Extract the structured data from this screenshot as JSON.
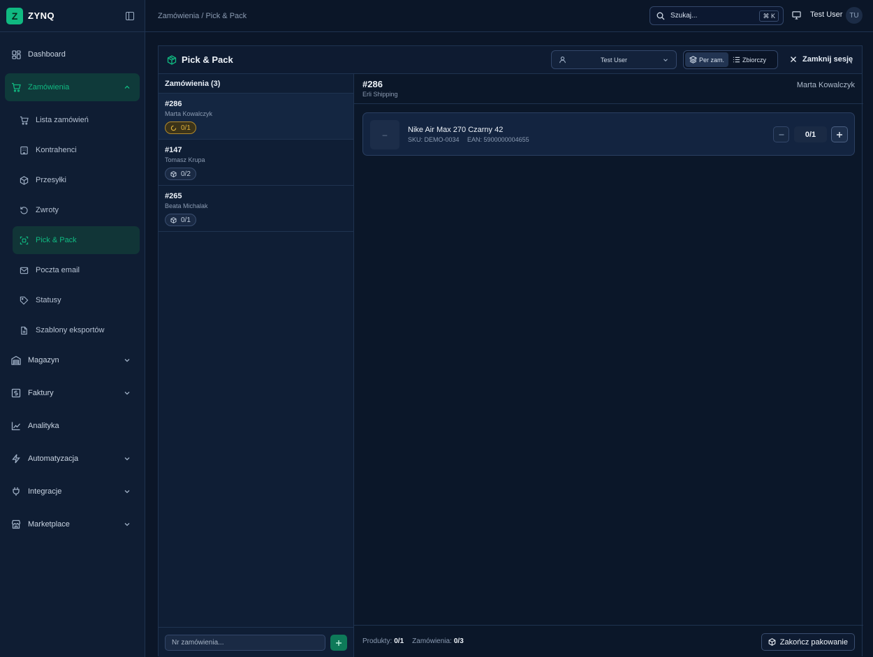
{
  "brand": {
    "logo_letter": "Z",
    "name": "ZYNQ"
  },
  "colors": {
    "accent": "#10b981",
    "warn": "#e0b23a",
    "background": "#0b1628"
  },
  "sidebar": {
    "items": [
      {
        "label": "Dashboard",
        "icon": "grid-icon"
      },
      {
        "label": "Zamówienia",
        "icon": "cart-icon",
        "open": true
      },
      {
        "label": "Magazyn",
        "icon": "warehouse-icon"
      },
      {
        "label": "Faktury",
        "icon": "invoice-icon"
      },
      {
        "label": "Analityka",
        "icon": "chart-icon"
      },
      {
        "label": "Automatyzacja",
        "icon": "bolt-icon"
      },
      {
        "label": "Integracje",
        "icon": "plug-icon"
      },
      {
        "label": "Marketplace",
        "icon": "store-icon"
      }
    ],
    "sub_items": [
      {
        "label": "Lista zamówień",
        "icon": "cart-icon"
      },
      {
        "label": "Kontrahenci",
        "icon": "building-icon"
      },
      {
        "label": "Przesyłki",
        "icon": "package-icon"
      },
      {
        "label": "Zwroty",
        "icon": "return-icon"
      },
      {
        "label": "Pick & Pack",
        "icon": "scan-icon",
        "active": true
      },
      {
        "label": "Poczta email",
        "icon": "mail-icon"
      },
      {
        "label": "Statusy",
        "icon": "tag-icon"
      },
      {
        "label": "Szablony eksportów",
        "icon": "file-icon"
      }
    ]
  },
  "topbar": {
    "breadcrumb": "Zamówienia / Pick & Pack",
    "search_label": "Szukaj...",
    "search_shortcut": "⌘ K",
    "user_name": "Test User",
    "user_initials": "TU"
  },
  "panel": {
    "title": "Pick & Pack",
    "user_select": "Test User",
    "modes": [
      {
        "label": "Per zam.",
        "active": true
      },
      {
        "label": "Zbiorczy",
        "active": false
      }
    ],
    "close_label": "Zamknij sesję"
  },
  "orders": {
    "header": "Zamówienia (3)",
    "list": [
      {
        "number": "#286",
        "customer": "Marta Kowalczyk",
        "progress": "0/1",
        "state": "in-progress"
      },
      {
        "number": "#147",
        "customer": "Tomasz Krupa",
        "progress": "0/2",
        "state": "pending"
      },
      {
        "number": "#265",
        "customer": "Beata Michalak",
        "progress": "0/1",
        "state": "pending"
      }
    ],
    "input_placeholder": "Nr zamówienia..."
  },
  "detail": {
    "number": "#286",
    "shipping": "Erli Shipping",
    "customer": "Marta Kowalczyk",
    "product": {
      "thumb": "–",
      "name": "Nike Air Max 270 Czarny 42",
      "sku": "SKU: DEMO-0034",
      "ean": "EAN: 5900000004655",
      "qty": "0/1"
    },
    "footer": {
      "products_label": "Produkty:",
      "products_value": "0/1",
      "orders_label": "Zamówienia:",
      "orders_value": "0/3",
      "finish_label": "Zakończ pakowanie"
    }
  }
}
